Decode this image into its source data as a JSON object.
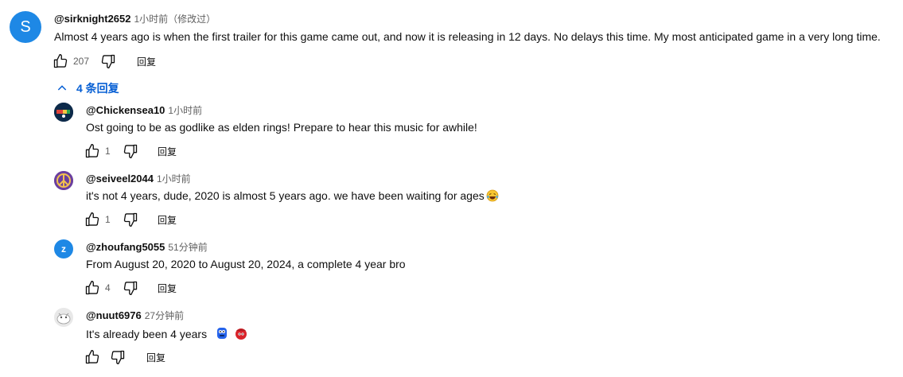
{
  "colors": {
    "accent": "#065fd4",
    "avatar_main": "#1e88e5",
    "avatar_zhou": "#1e88e5",
    "muted": "#606060"
  },
  "main_comment": {
    "avatar_letter": "S",
    "handle": "@sirknight2652",
    "time": "1小时前（修改过）",
    "text": "Almost 4 years ago is when the first trailer for this game came out, and now it is releasing in 12 days. No delays this time. My most anticipated game in a very long time.",
    "likes": "207",
    "reply_label": "回复"
  },
  "replies_toggle": {
    "icon": "chevron-up-icon",
    "label": "4 条回复"
  },
  "replies": [
    {
      "handle": "@Chickensea10",
      "time": "1小时前",
      "text": "Ost going to be as godlike as elden rings! Prepare to hear this music for awhile!",
      "likes": "1",
      "reply_label": "回复"
    },
    {
      "handle": "@seiveel2044",
      "time": "1小时前",
      "text": "it's not 4 years, dude, 2020 is almost 5 years ago. we have been waiting for ages",
      "emoji": "laughing-tears-emoji",
      "likes": "1",
      "reply_label": "回复"
    },
    {
      "handle": "@zhoufang5055",
      "avatar_letter": "z",
      "time": "51分钟前",
      "text": "From August 20, 2020 to August 20, 2024, a complete 4 year bro",
      "likes": "4",
      "reply_label": "回复"
    },
    {
      "handle": "@nuut6976",
      "time": "27分钟前",
      "text": "It's already been 4 years",
      "emoji": [
        "blue-character-emoji",
        "red-character-emoji"
      ],
      "likes": "",
      "reply_label": "回复"
    }
  ]
}
